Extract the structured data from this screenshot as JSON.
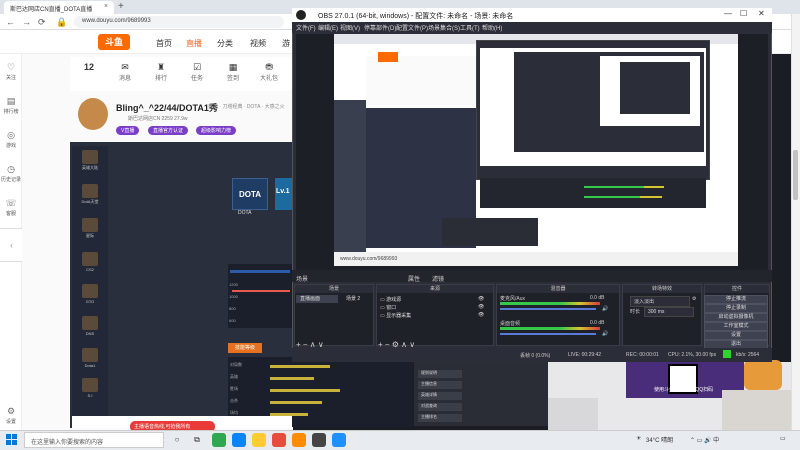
{
  "browser": {
    "tab_title": "斯巴达网店CN直播_DOTA直播",
    "url": "www.douyu.com/9689993"
  },
  "site": {
    "nav": [
      "首页",
      "直播",
      "分类",
      "视频",
      "游"
    ],
    "stats": [
      {
        "value": "12",
        "label": ""
      },
      {
        "value": "",
        "label": "消息"
      },
      {
        "value": "",
        "label": "排行"
      },
      {
        "value": "",
        "label": "任务"
      },
      {
        "value": "",
        "label": "签到"
      },
      {
        "value": "",
        "label": "大礼包"
      }
    ],
    "room_title": "Bling^_^22/44/DOTA1秀",
    "room_sub": "英雄 · 刀塔经典 · DOTA · 大感之火",
    "room_meta": "斯巴达网店CN   2259   27.9w",
    "badges": [
      "V直播",
      "直播官方认证",
      "超级影响力榜"
    ],
    "left_rail": [
      "关注",
      "排行榜",
      "游戏",
      "历史记录",
      "客服",
      "设置"
    ]
  },
  "stream": {
    "game_cards": [
      "DOTA",
      "Lv.1"
    ],
    "game_label": "DOTA",
    "side_games": [
      "英雄大陆",
      "DotA天堂",
      "星际",
      "CS2",
      "GTO",
      "DNS",
      "Dota1",
      "S.I"
    ],
    "graph_y": [
      "1200",
      "1000",
      "800",
      "600",
      "400"
    ],
    "orange_btn": "技能等级",
    "red_banner": "主播语音热线,可抢我所有",
    "table_rows": [
      "对局数",
      "英雄",
      "胜场",
      "击杀",
      "场均"
    ],
    "right_menu": [
      "规则说明",
      "主播信息",
      "英雄详情",
      "对战查询",
      "主播排名"
    ]
  },
  "obs": {
    "title": "OBS 27.0.1 (64-bit, windows) - 配置文件: 未命名 - 场景: 未命名",
    "menu": [
      "文件(F)",
      "编辑(E)",
      "视图(V)",
      "停靠部件(D)",
      "配置文件(P)",
      "场景集合(S)",
      "工具(T)",
      "帮助(H)"
    ],
    "nested_url": "www.douyu.com/9689993",
    "docks_hdr": [
      "属性",
      "滤镜"
    ],
    "dock_titles": {
      "scenes": "场景",
      "sources": "来源",
      "mixer": "混音器",
      "transitions": "转场特效",
      "controls": "控件"
    },
    "scenes": [
      "直播画面",
      "场景 2"
    ],
    "sources": [
      "游戏源",
      "窗口",
      "显示器采集"
    ],
    "mixer": [
      {
        "name": "麦克风/Aux",
        "vol": "0.0 dB"
      },
      {
        "name": "桌面音频",
        "vol": "0.0 dB"
      }
    ],
    "transition": {
      "type": "淡入淡出",
      "duration_label": "时长",
      "duration": "300 ms"
    },
    "controls": [
      "停止推流",
      "停止录制",
      "启动虚拟摄像机",
      "工作室模式",
      "设置",
      "退出"
    ],
    "status": {
      "dropped": "丢帧 0 (0.0%)",
      "live": "LIVE: 00:29:42",
      "rec": "REC: 00:00:01",
      "cpu": "CPU: 2.1%, 30.00 fps",
      "kbps": "kb/s: 2564"
    }
  },
  "ads": {
    "qr_text": "使用斗鱼APP扫码,QQ扫码"
  },
  "taskbar": {
    "search": "在这里输入你要搜索的内容",
    "weather": "34°C 晴朗",
    "time": "",
    "colors": [
      "#1e90ff",
      "#ffcc33",
      "#0078d4",
      "#2fa84f",
      "#e74c3c",
      "#ff8c00",
      "#7a3cc9",
      "#444444",
      "#0a84ff"
    ]
  }
}
